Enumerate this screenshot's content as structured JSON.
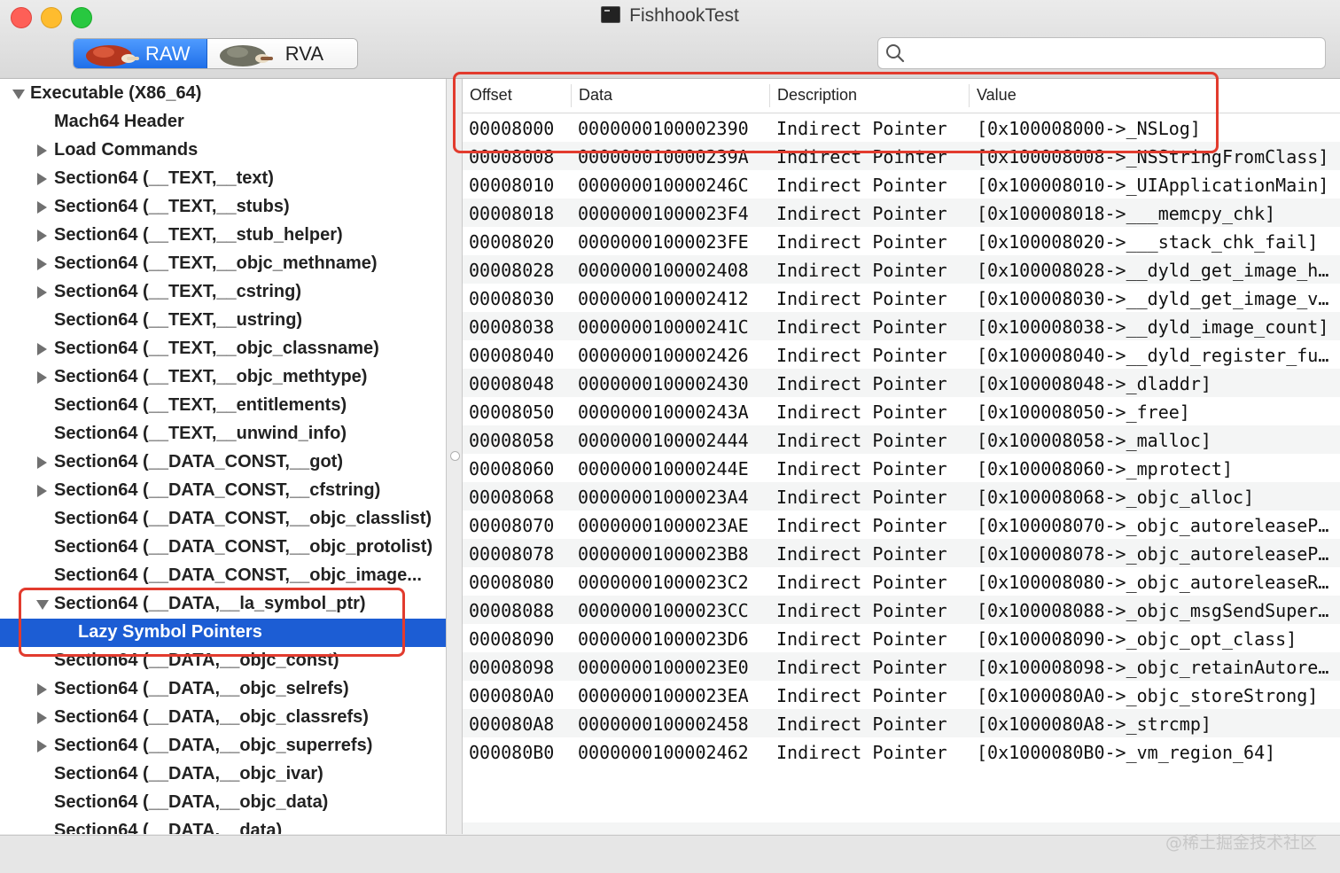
{
  "window": {
    "title": "FishhookTest"
  },
  "toolbar": {
    "segments": [
      {
        "label": "RAW",
        "selected": true
      },
      {
        "label": "RVA",
        "selected": false
      }
    ],
    "search": {
      "value": "",
      "placeholder": ""
    }
  },
  "tree": {
    "rows": [
      {
        "label": "Executable  (X86_64)",
        "level": 0,
        "disclosure": "down",
        "selected": false
      },
      {
        "label": "Mach64 Header",
        "level": 1,
        "disclosure": "none",
        "selected": false
      },
      {
        "label": "Load Commands",
        "level": 1,
        "disclosure": "right",
        "selected": false
      },
      {
        "label": "Section64 (__TEXT,__text)",
        "level": 1,
        "disclosure": "right",
        "selected": false
      },
      {
        "label": "Section64 (__TEXT,__stubs)",
        "level": 1,
        "disclosure": "right",
        "selected": false
      },
      {
        "label": "Section64 (__TEXT,__stub_helper)",
        "level": 1,
        "disclosure": "right",
        "selected": false
      },
      {
        "label": "Section64 (__TEXT,__objc_methname)",
        "level": 1,
        "disclosure": "right",
        "selected": false
      },
      {
        "label": "Section64 (__TEXT,__cstring)",
        "level": 1,
        "disclosure": "right",
        "selected": false
      },
      {
        "label": "Section64 (__TEXT,__ustring)",
        "level": 1,
        "disclosure": "none",
        "selected": false
      },
      {
        "label": "Section64 (__TEXT,__objc_classname)",
        "level": 1,
        "disclosure": "right",
        "selected": false
      },
      {
        "label": "Section64 (__TEXT,__objc_methtype)",
        "level": 1,
        "disclosure": "right",
        "selected": false
      },
      {
        "label": "Section64 (__TEXT,__entitlements)",
        "level": 1,
        "disclosure": "none",
        "selected": false
      },
      {
        "label": "Section64 (__TEXT,__unwind_info)",
        "level": 1,
        "disclosure": "none",
        "selected": false
      },
      {
        "label": "Section64 (__DATA_CONST,__got)",
        "level": 1,
        "disclosure": "right",
        "selected": false
      },
      {
        "label": "Section64 (__DATA_CONST,__cfstring)",
        "level": 1,
        "disclosure": "right",
        "selected": false
      },
      {
        "label": "Section64 (__DATA_CONST,__objc_classlist)",
        "level": 1,
        "disclosure": "none",
        "selected": false
      },
      {
        "label": "Section64 (__DATA_CONST,__objc_protolist)",
        "level": 1,
        "disclosure": "none",
        "selected": false
      },
      {
        "label": "Section64 (__DATA_CONST,__objc_image...",
        "level": 1,
        "disclosure": "none",
        "selected": false
      },
      {
        "label": "Section64 (__DATA,__la_symbol_ptr)",
        "level": 1,
        "disclosure": "down",
        "selected": false
      },
      {
        "label": "Lazy Symbol Pointers",
        "level": 2,
        "disclosure": "none",
        "selected": true
      },
      {
        "label": "Section64 (__DATA,__objc_const)",
        "level": 1,
        "disclosure": "none",
        "selected": false
      },
      {
        "label": "Section64 (__DATA,__objc_selrefs)",
        "level": 1,
        "disclosure": "right",
        "selected": false
      },
      {
        "label": "Section64 (__DATA,__objc_classrefs)",
        "level": 1,
        "disclosure": "right",
        "selected": false
      },
      {
        "label": "Section64 (__DATA,__objc_superrefs)",
        "level": 1,
        "disclosure": "right",
        "selected": false
      },
      {
        "label": "Section64 (__DATA,__objc_ivar)",
        "level": 1,
        "disclosure": "none",
        "selected": false
      },
      {
        "label": "Section64 (__DATA,__objc_data)",
        "level": 1,
        "disclosure": "none",
        "selected": false
      },
      {
        "label": "Section64 (__DATA,__data)",
        "level": 1,
        "disclosure": "none",
        "selected": false
      }
    ]
  },
  "table": {
    "columns": [
      "Offset",
      "Data",
      "Description",
      "Value"
    ],
    "rows": [
      [
        "00008000",
        "0000000100002390",
        "Indirect Pointer",
        "[0x100008000->_NSLog]"
      ],
      [
        "00008008",
        "000000010000239A",
        "Indirect Pointer",
        "[0x100008008->_NSStringFromClass]"
      ],
      [
        "00008010",
        "000000010000246C",
        "Indirect Pointer",
        "[0x100008010->_UIApplicationMain]"
      ],
      [
        "00008018",
        "00000001000023F4",
        "Indirect Pointer",
        "[0x100008018->___memcpy_chk]"
      ],
      [
        "00008020",
        "00000001000023FE",
        "Indirect Pointer",
        "[0x100008020->___stack_chk_fail]"
      ],
      [
        "00008028",
        "0000000100002408",
        "Indirect Pointer",
        "[0x100008028->__dyld_get_image_h…"
      ],
      [
        "00008030",
        "0000000100002412",
        "Indirect Pointer",
        "[0x100008030->__dyld_get_image_v…"
      ],
      [
        "00008038",
        "000000010000241C",
        "Indirect Pointer",
        "[0x100008038->__dyld_image_count]"
      ],
      [
        "00008040",
        "0000000100002426",
        "Indirect Pointer",
        "[0x100008040->__dyld_register_fu…"
      ],
      [
        "00008048",
        "0000000100002430",
        "Indirect Pointer",
        "[0x100008048->_dladdr]"
      ],
      [
        "00008050",
        "000000010000243A",
        "Indirect Pointer",
        "[0x100008050->_free]"
      ],
      [
        "00008058",
        "0000000100002444",
        "Indirect Pointer",
        "[0x100008058->_malloc]"
      ],
      [
        "00008060",
        "000000010000244E",
        "Indirect Pointer",
        "[0x100008060->_mprotect]"
      ],
      [
        "00008068",
        "00000001000023A4",
        "Indirect Pointer",
        "[0x100008068->_objc_alloc]"
      ],
      [
        "00008070",
        "00000001000023AE",
        "Indirect Pointer",
        "[0x100008070->_objc_autoreleaseP…"
      ],
      [
        "00008078",
        "00000001000023B8",
        "Indirect Pointer",
        "[0x100008078->_objc_autoreleaseP…"
      ],
      [
        "00008080",
        "00000001000023C2",
        "Indirect Pointer",
        "[0x100008080->_objc_autoreleaseR…"
      ],
      [
        "00008088",
        "00000001000023CC",
        "Indirect Pointer",
        "[0x100008088->_objc_msgSendSuper2]"
      ],
      [
        "00008090",
        "00000001000023D6",
        "Indirect Pointer",
        "[0x100008090->_objc_opt_class]"
      ],
      [
        "00008098",
        "00000001000023E0",
        "Indirect Pointer",
        "[0x100008098->_objc_retainAutore…"
      ],
      [
        "000080A0",
        "00000001000023EA",
        "Indirect Pointer",
        "[0x1000080A0->_objc_storeStrong]"
      ],
      [
        "000080A8",
        "0000000100002458",
        "Indirect Pointer",
        "[0x1000080A8->_strcmp]"
      ],
      [
        "000080B0",
        "0000000100002462",
        "Indirect Pointer",
        "[0x1000080B0->_vm_region_64]"
      ]
    ]
  },
  "watermark": "@稀土掘金技术社区",
  "colors": {
    "selection": "#1c5dd4",
    "highlight_box": "#e23b2e",
    "row_alt": "#f4f5f5"
  }
}
